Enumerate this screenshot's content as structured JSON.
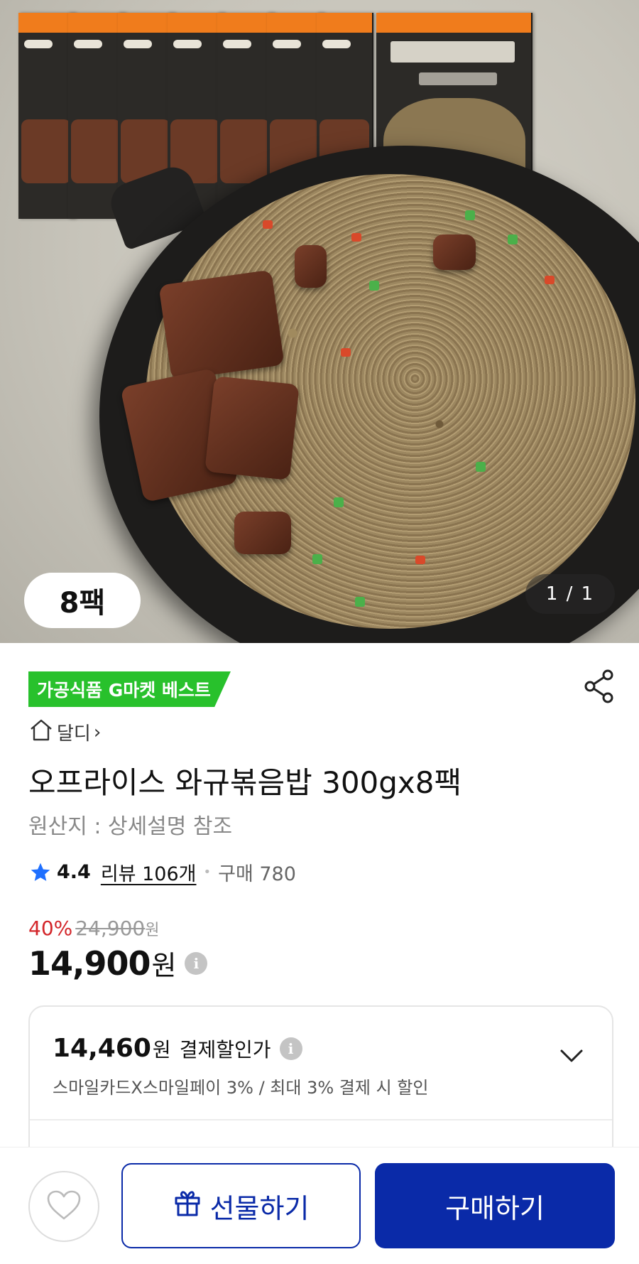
{
  "product_image": {
    "pack_badge": "8팩",
    "counter": "1 / 1"
  },
  "badge": {
    "text": "가공식품 G마켓 베스트"
  },
  "store": {
    "name": "달디",
    "arrow": "›"
  },
  "product": {
    "title": "오프라이스 와규볶음밥 300gx8팩",
    "origin": "원산지 : 상세설명 참조"
  },
  "rating": {
    "score": "4.4",
    "reviews": "리뷰 106개",
    "separator": "•",
    "sales": "구매 780"
  },
  "price": {
    "discount_pct": "40%",
    "original": "24,900",
    "original_unit": "원",
    "current": "14,900",
    "unit": "원",
    "info_glyph": "i"
  },
  "payment_discount": {
    "price": "14,460",
    "unit": "원",
    "label": "결제할인가",
    "info_glyph": "i",
    "description": "스마일카드X스마일페이 3% / 최대 3% 결제 시 할인"
  },
  "actions": {
    "gift_label": "선물하기",
    "buy_label": "구매하기"
  },
  "colors": {
    "badge_green": "#28c12c",
    "discount_red": "#d3262a",
    "primary_blue": "#0a2aa8"
  },
  "icons": {
    "share": "share-icon",
    "home": "home-icon",
    "star": "star-icon",
    "info": "info-icon",
    "chevron": "chevron-down-icon",
    "heart": "heart-icon",
    "gift": "gift-icon"
  }
}
